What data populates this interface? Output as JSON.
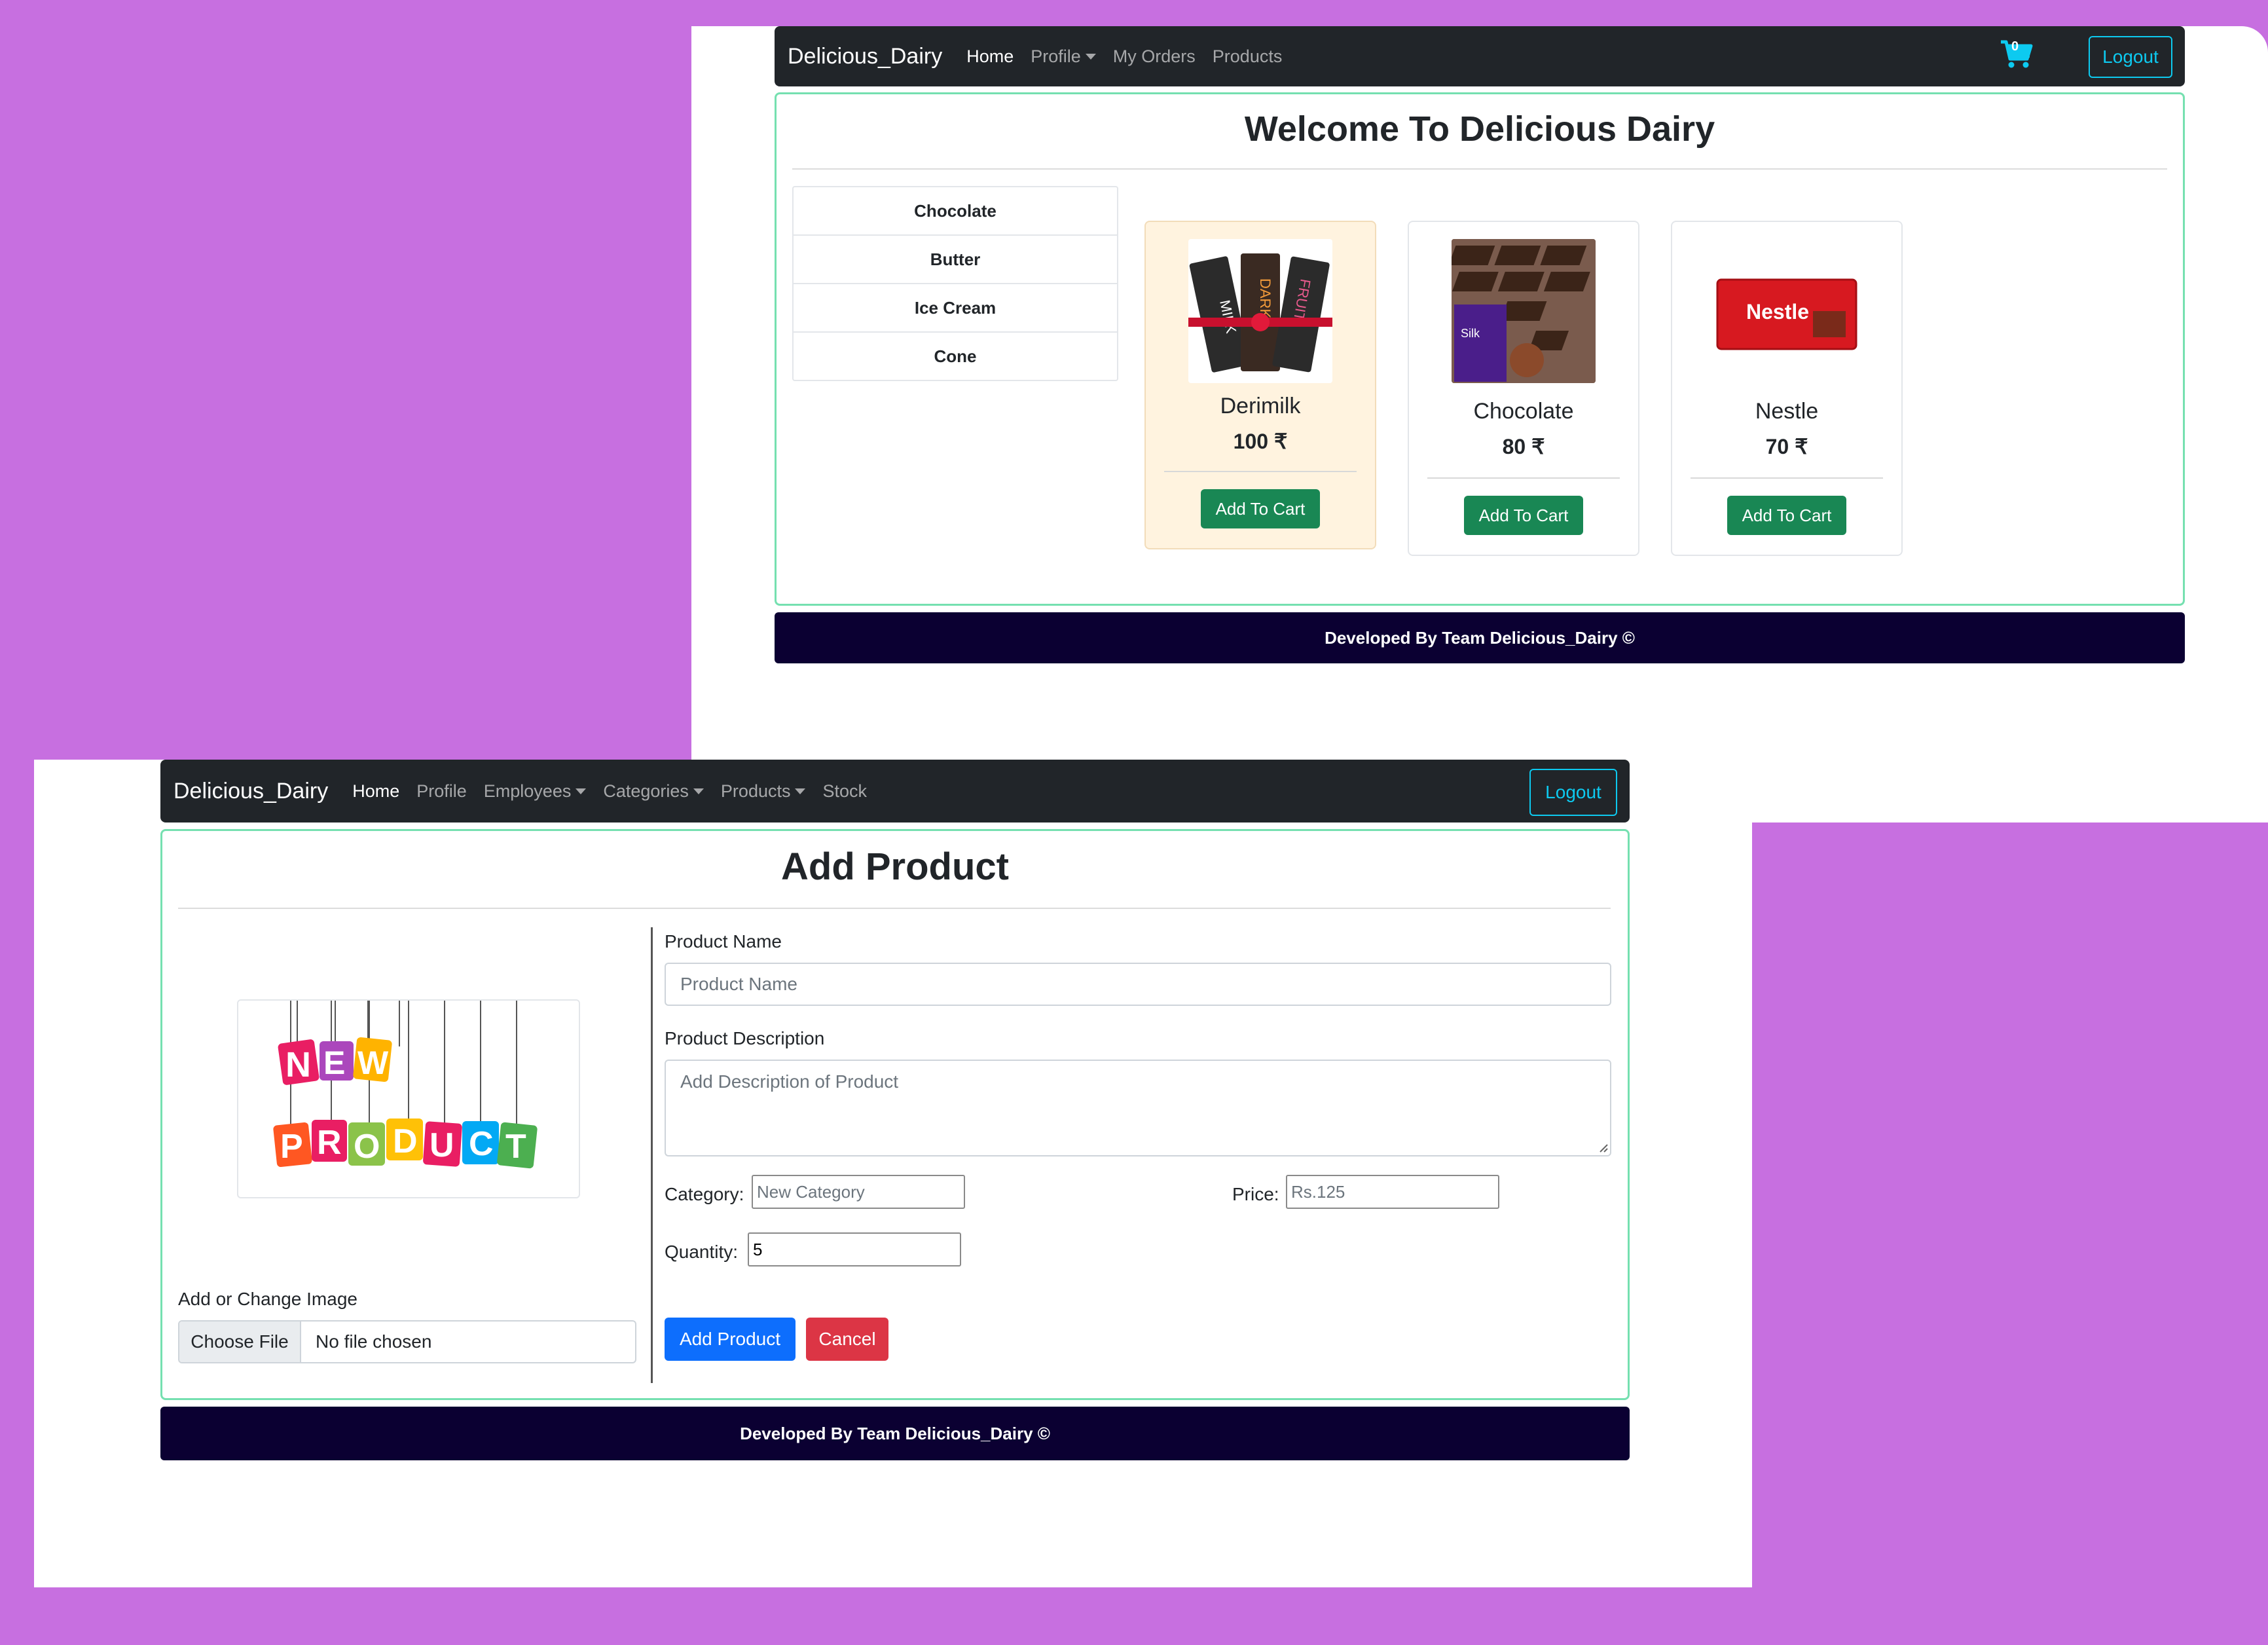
{
  "top": {
    "brand": "Delicious_Dairy",
    "nav": {
      "home": "Home",
      "profile": "Profile",
      "orders": "My Orders",
      "products": "Products"
    },
    "cart_count": "0",
    "logout": "Logout",
    "title": "Welcome To Delicious Dairy",
    "categories": [
      "Chocolate",
      "Butter",
      "Ice Cream",
      "Cone"
    ],
    "products": [
      {
        "name": "Derimilk",
        "price": "100 ₹",
        "button": "Add To Cart",
        "image": "dairy-milk-bars-image"
      },
      {
        "name": "Chocolate",
        "price": "80 ₹",
        "button": "Add To Cart",
        "image": "chocolate-pack-image"
      },
      {
        "name": "Nestle",
        "price": "70 ₹",
        "button": "Add To Cart",
        "image": "nestle-bar-image"
      }
    ],
    "footer": "Developed By Team Delicious_Dairy ©"
  },
  "bottom": {
    "brand": "Delicious_Dairy",
    "nav": {
      "home": "Home",
      "profile": "Profile",
      "employees": "Employees",
      "categories": "Categories",
      "products": "Products",
      "stock": "Stock"
    },
    "logout": "Logout",
    "title": "Add Product",
    "image_tag": "NEW PRODUCT",
    "image_label": "Add or Change Image",
    "choose_file": "Choose File",
    "no_file": "No file chosen",
    "product_name_label": "Product Name",
    "product_name_placeholder": "Product Name",
    "description_label": "Product Description",
    "description_placeholder": "Add Description of Product",
    "category_label": "Category:",
    "category_placeholder": "New Category",
    "price_label": "Price:",
    "price_placeholder": "Rs.125",
    "quantity_label": "Quantity:",
    "quantity_value": "5",
    "add_button": "Add Product",
    "cancel_button": "Cancel",
    "footer": "Developed By Team Delicious_Dairy ©"
  },
  "colors": {
    "background": "#c76fe0",
    "navbar": "#212529",
    "panel_border": "#75e0b0",
    "footer": "#0b0032",
    "success": "#198754",
    "primary": "#0d6efd",
    "danger": "#dc3545",
    "info": "#0dcaf0"
  }
}
